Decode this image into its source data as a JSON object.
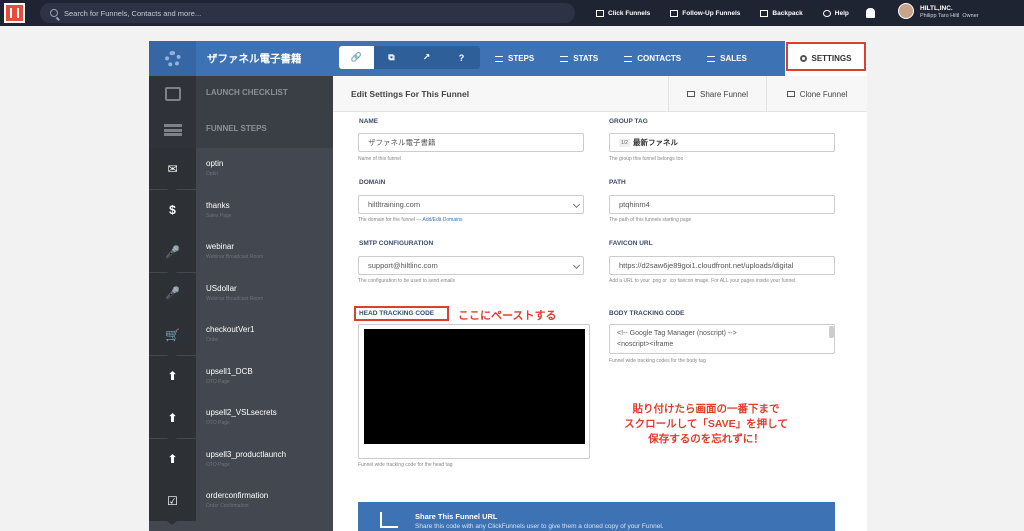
{
  "topnav": {
    "search_placeholder": "Search for Funnels, Contacts and more...",
    "links": [
      "Click Funnels",
      "Follow-Up Funnels",
      "Backpack",
      "Help"
    ],
    "company": "HILTL,INC.",
    "user": "Philipp Taro Hiltl",
    "role": "Owner"
  },
  "funnel": {
    "name": "ザファネル電子書籍",
    "pills": [
      "🔗",
      "⧉",
      "↗",
      "?"
    ],
    "tabs": [
      "STEPS",
      "STATS",
      "CONTACTS",
      "SALES"
    ],
    "settings_tab": "SETTINGS"
  },
  "sidebar": {
    "launch_checklist": "LAUNCH CHECKLIST",
    "funnel_steps": "FUNNEL STEPS",
    "steps": [
      {
        "name": "optin",
        "type": "Optin",
        "icon": "✉"
      },
      {
        "name": "thanks",
        "type": "Sales Page",
        "icon": "$"
      },
      {
        "name": "webinar",
        "type": "Webinar Broadcast Room",
        "icon": "🎤"
      },
      {
        "name": "USdollar",
        "type": "Webinar Broadcast Room",
        "icon": "🎤"
      },
      {
        "name": "checkoutVer1",
        "type": "Order",
        "icon": "🛒"
      },
      {
        "name": "upsell1_DCB",
        "type": "OTO Page",
        "icon": "⬆"
      },
      {
        "name": "upsell2_VSLsecrets",
        "type": "OTO Page",
        "icon": "⬆"
      },
      {
        "name": "upsell3_productlaunch",
        "type": "OTO Page",
        "icon": "⬆"
      },
      {
        "name": "orderconfirmation",
        "type": "Order Confirmation",
        "icon": "☑"
      }
    ]
  },
  "content": {
    "title": "Edit Settings For This Funnel",
    "share_btn": "Share Funnel",
    "clone_btn": "Clone Funnel",
    "name_label": "NAME",
    "name_value": "ザファネル電子書籍",
    "name_help": "Name of this funnel",
    "group_label": "GROUP TAG",
    "group_chip": "1/2",
    "group_value": "最新ファネル",
    "group_help": "The group this funnel belongs too",
    "domain_label": "DOMAIN",
    "domain_value": "hiltltraining.com",
    "domain_help": "The domain for the funnel —",
    "domain_link": "Add/Edit Domains",
    "path_label": "PATH",
    "path_value": "ptqhinm4",
    "path_help": "The path of this funnels starting page",
    "smtp_label": "SMTP CONFIGURATION",
    "smtp_value": "support@hiltlinc.com",
    "smtp_help": "The configuration to be used to send emails",
    "favicon_label": "FAVICON URL",
    "favicon_value": "https://d2saw6je89goi1.cloudfront.net/uploads/digital",
    "favicon_help": "Add a URL to your .png or .ico favicon image. For ALL your pages inside your funnel.",
    "head_label": "HEAD TRACKING CODE",
    "head_help": "Funnel wide tracking code for the head tag",
    "body_label": "BODY TRACKING CODE",
    "body_line1": "<!-- Google Tag Manager (noscript) -->",
    "body_line2": "<noscript><iframe",
    "body_help": "Funnel wide tracking codes for the body tag"
  },
  "annotations": {
    "paste_here": "ここにペーストする",
    "note_line1": "貼り付けたら画面の一番下まで",
    "note_line2": "スクロールして「SAVE」を押して",
    "note_line3": "保存するのを忘れずに！"
  },
  "share_banner": {
    "title": "Share This Funnel URL",
    "subtitle": "Share this code with any ClickFunnels user to give them a cloned copy of your Funnel."
  },
  "colors": {
    "brand_blue": "#3d73b5",
    "sidebar_dark": "#43474f",
    "nav_dark": "#1f2433",
    "annotation_red": "#e03d2e"
  }
}
